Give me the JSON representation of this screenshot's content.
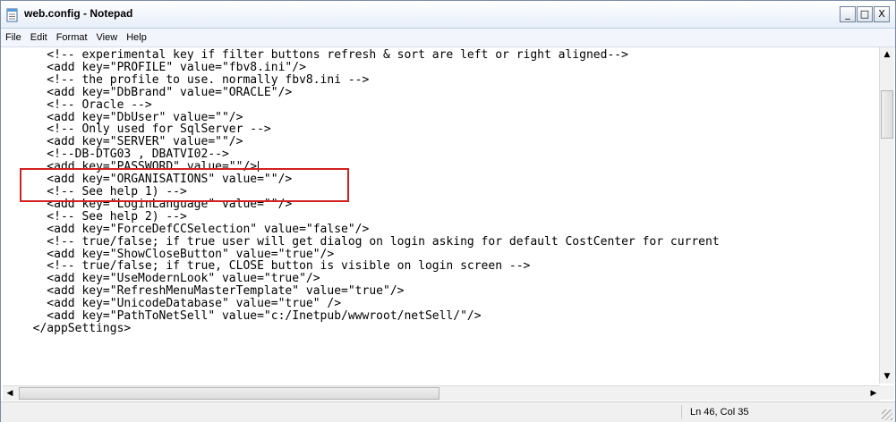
{
  "window": {
    "title": "web.config - Notepad",
    "controls": {
      "minimize": "_",
      "maximize": "□",
      "close": "X"
    }
  },
  "menu": [
    "File",
    "Edit",
    "Format",
    "View",
    "Help"
  ],
  "editor": {
    "lines": [
      "    <!-- experimental key if filter buttons refresh & sort are left or right aligned-->",
      "    <add key=\"PROFILE\" value=\"fbv8.ini\"/>",
      "    <!-- the profile to use. normally fbv8.ini -->",
      "    <add key=\"DbBrand\" value=\"ORACLE\"/>",
      "    <!-- Oracle -->",
      "    <add key=\"DbUser\" value=\"\"/>",
      "    <!-- Only used for SqlServer -->",
      "    <add key=\"SERVER\" value=\"\"/>",
      "    <!--DB-DTG03 , DBATVI02-->",
      "    <add key=\"PASSWORD\" value=\"\"/>",
      "    <add key=\"ORGANISATIONS\" value=\"\"/>",
      "    <!-- See help 1) -->",
      "    <add key=\"LoginLanguage\" value=\"\"/>",
      "    <!-- See help 2) -->",
      "    <add key=\"ForceDefCCSelection\" value=\"false\"/>",
      "    <!-- true/false; if true user will get dialog on login asking for default CostCenter for current",
      "    <add key=\"ShowCloseButton\" value=\"true\"/>",
      "    <!-- true/false; if true, CLOSE button is visible on login screen -->",
      "    <add key=\"UseModernLook\" value=\"true\"/>",
      "    <add key=\"RefreshMenuMasterTemplate\" value=\"true\"/>",
      "    <add key=\"UnicodeDatabase\" value=\"true\" />",
      "    <add key=\"PathToNetSell\" value=\"c:/Inetpub/wwwroot/netSell/\"/>",
      "  </appSettings>"
    ]
  },
  "status": {
    "position": "Ln 46, Col 35"
  },
  "colors": {
    "highlight_border": "#d32121",
    "titlebar_text": "#000000"
  },
  "icons": [
    "notepad-icon",
    "minimize-icon",
    "maximize-icon",
    "close-icon",
    "scroll-up-icon",
    "scroll-down-icon",
    "scroll-left-icon",
    "scroll-right-icon",
    "size-grip-icon"
  ]
}
